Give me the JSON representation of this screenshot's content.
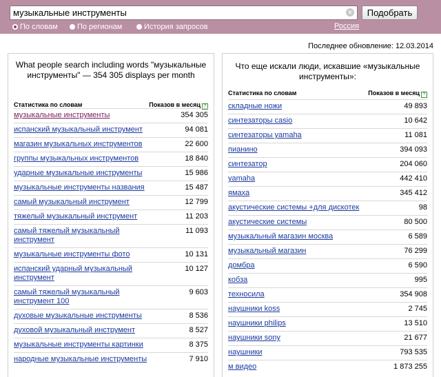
{
  "search": {
    "query": "музыкальные инструменты",
    "submit_label": "Подобрать",
    "clear_glyph": "✕"
  },
  "tabs": [
    {
      "label": "По словам",
      "selected": true
    },
    {
      "label": "По регионам",
      "selected": false
    },
    {
      "label": "История запросов",
      "selected": false
    }
  ],
  "region_label": "Россия",
  "update_text": "Последнее обновление: 12.03.2014",
  "left_panel": {
    "title": "What people search including words \"музыкальные инструменты\" — 354 305 displays per month",
    "col_keyword": "Статистика по словам",
    "col_count": "Показов в месяц",
    "rows": [
      {
        "keyword": "музыкальные инструменты",
        "count": "354 305"
      },
      {
        "keyword": "испанский музыкальный инструмент",
        "count": "94 081"
      },
      {
        "keyword": "магазин музыкальных инструментов",
        "count": "22 600"
      },
      {
        "keyword": "группы музыкальных инструментов",
        "count": "18 840"
      },
      {
        "keyword": "ударные музыкальные инструменты",
        "count": "15 986"
      },
      {
        "keyword": "музыкальные инструменты названия",
        "count": "15 487"
      },
      {
        "keyword": "самый музыкальный инструмент",
        "count": "12 799"
      },
      {
        "keyword": "тяжелый музыкальный инструмент",
        "count": "11 203"
      },
      {
        "keyword": "самый тяжелый музыкальный инструмент",
        "count": "11 093"
      },
      {
        "keyword": "музыкальные инструменты фото",
        "count": "10 131"
      },
      {
        "keyword": "испанский ударный музыкальный инструмент",
        "count": "10 127"
      },
      {
        "keyword": "самый тяжелый музыкальный инструмент 100",
        "count": "9 603"
      },
      {
        "keyword": "духовые музыкальные инструменты",
        "count": "8 536"
      },
      {
        "keyword": "духовой музыкальный инструмент",
        "count": "8 527"
      },
      {
        "keyword": "музыкальные инструменты картинки",
        "count": "8 375"
      },
      {
        "keyword": "народные музыкальные инструменты",
        "count": "7 910"
      }
    ]
  },
  "right_panel": {
    "title": "Что еще искали люди, искавшие «музыкальные инструменты»:",
    "col_keyword": "Статистика по словам",
    "col_count": "Показов в месяц",
    "rows": [
      {
        "keyword": "складные ножи",
        "count": "49 893"
      },
      {
        "keyword": "синтезаторы casio",
        "count": "10 642"
      },
      {
        "keyword": "синтезаторы yamaha",
        "count": "11 081"
      },
      {
        "keyword": "пианино",
        "count": "394 093"
      },
      {
        "keyword": "синтезатор",
        "count": "204 060"
      },
      {
        "keyword": "yamaha",
        "count": "442 410"
      },
      {
        "keyword": "ямаха",
        "count": "345 412"
      },
      {
        "keyword": "акустические системы +для дискотек",
        "count": "98"
      },
      {
        "keyword": "акустические системы",
        "count": "80 500"
      },
      {
        "keyword": "музыкальный магазин москва",
        "count": "6 589"
      },
      {
        "keyword": "музыкальный магазин",
        "count": "76 299"
      },
      {
        "keyword": "домбра",
        "count": "6 590"
      },
      {
        "keyword": "кобза",
        "count": "995"
      },
      {
        "keyword": "техносила",
        "count": "354 908"
      },
      {
        "keyword": "наушники koss",
        "count": "2 745"
      },
      {
        "keyword": "наушники philips",
        "count": "13 510"
      },
      {
        "keyword": "наушники sony",
        "count": "21 677"
      },
      {
        "keyword": "наушники",
        "count": "793 535"
      },
      {
        "keyword": "м видео",
        "count": "1 873 255"
      }
    ]
  }
}
